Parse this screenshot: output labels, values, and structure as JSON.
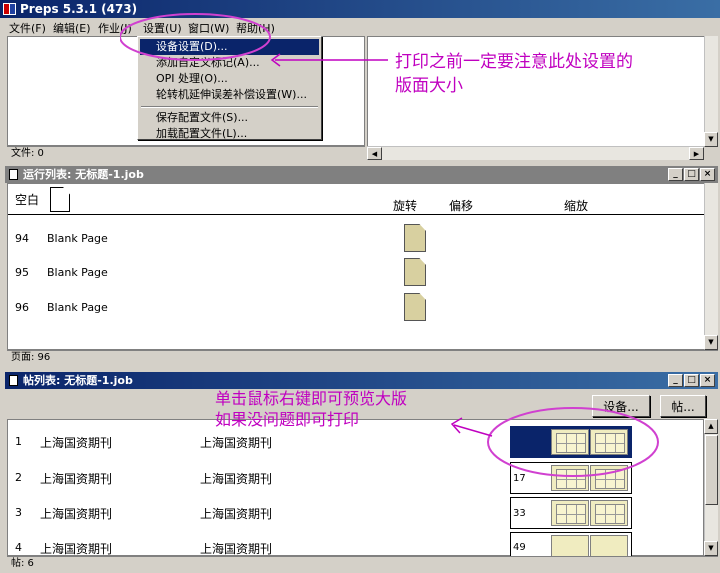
{
  "app": {
    "title": "Preps 5.3.1 (473)"
  },
  "menubar": {
    "items": [
      {
        "label": "文件(F)"
      },
      {
        "label": "编辑(E)"
      },
      {
        "label": "作业(J)"
      },
      {
        "label": "设置(U)"
      },
      {
        "label": "窗口(W)"
      },
      {
        "label": "帮助(H)"
      }
    ]
  },
  "dropdown": {
    "items": [
      {
        "label": "设备设置(D)..."
      },
      {
        "label": "添加自定义标记(A)..."
      },
      {
        "label": "OPI 处理(O)..."
      },
      {
        "label": "轮转机延伸误差补偿设置(W)..."
      },
      {
        "label": "保存配置文件(S)..."
      },
      {
        "label": "加载配置文件(L)..."
      }
    ]
  },
  "files_status": "文件: 0",
  "run_list": {
    "title": "运行列表: 无标题-1.job",
    "header": {
      "blank": "空白",
      "rotate": "旋转",
      "offset": "偏移",
      "scale": "缩放"
    },
    "rows": [
      {
        "num": "94",
        "name": "Blank Page"
      },
      {
        "num": "95",
        "name": "Blank Page"
      },
      {
        "num": "96",
        "name": "Blank Page"
      }
    ],
    "status": "页面: 96"
  },
  "sig_list": {
    "title": "帖列表: 无标题-1.job",
    "device_button": "设备...",
    "sig_button": "帖...",
    "rows": [
      {
        "num": "1",
        "name": "上海国资期刊",
        "name2": "上海国资期刊",
        "page": ""
      },
      {
        "num": "2",
        "name": "上海国资期刊",
        "name2": "上海国资期刊",
        "page": "17"
      },
      {
        "num": "3",
        "name": "上海国资期刊",
        "name2": "上海国资期刊",
        "page": "33"
      },
      {
        "num": "4",
        "name": "上海国资期刊",
        "name2": "上海国资期刊",
        "page": "49"
      }
    ],
    "status": "帖: 6"
  },
  "annotations": {
    "top_line1": "打印之前一定要注意此处设置的",
    "top_line2": "版面大小",
    "bottom_line1": "单击鼠标右键即可预览大版",
    "bottom_line2": "如果没问题即可打印",
    "color": "#c000c0"
  },
  "colors": {
    "titlebar": "#0a246a",
    "selection": "#0a246a",
    "chrome": "#d4d0c8"
  },
  "icons": {
    "app": "preps-app-icon",
    "page": "page-icon",
    "signature": "signature-thumbnail-icon"
  }
}
